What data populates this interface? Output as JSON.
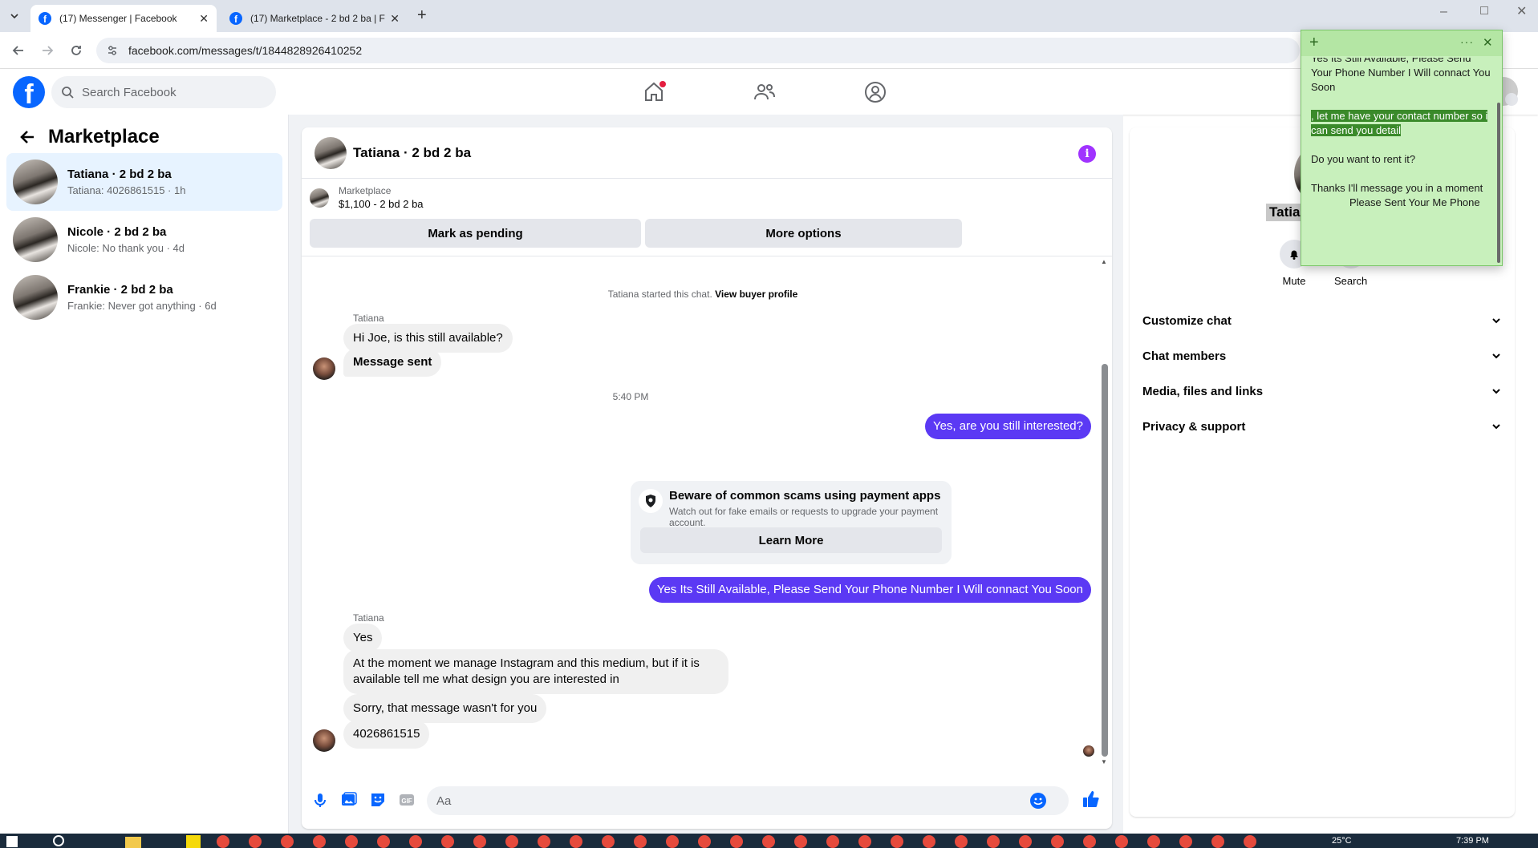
{
  "browser": {
    "tabs": [
      {
        "label": "(17) Messenger | Facebook",
        "active": true
      },
      {
        "label": "(17) Marketplace - 2 bd 2 ba | F",
        "active": false
      }
    ],
    "url": "facebook.com/messages/t/1844828926410252",
    "favicon_letter": "f"
  },
  "fb": {
    "logo_letter": "f",
    "search_placeholder": "Search Facebook",
    "nav_icons": [
      "home-icon",
      "friends-icon",
      "groups-icon"
    ]
  },
  "sidebar": {
    "title": "Marketplace",
    "conversations": [
      {
        "name": "Tatiana · 2 bd 2 ba",
        "preview": "Tatiana: 4026861515 · 1h",
        "selected": true
      },
      {
        "name": "Nicole · 2 bd 2 ba",
        "preview": "Nicole: No thank you · 4d",
        "selected": false
      },
      {
        "name": "Frankie · 2 bd 2 ba",
        "preview": "Frankie: Never got anything · 6d",
        "selected": false
      }
    ]
  },
  "chat": {
    "title": "Tatiana · 2 bd 2 ba",
    "info_glyph": "i",
    "listing": {
      "label": "Marketplace",
      "detail": "$1,100 - 2 bd 2 ba"
    },
    "actions": {
      "pending": "Mark as pending",
      "more": "More options"
    },
    "started_text": "Tatiana started this chat.",
    "view_profile": "View buyer profile",
    "sender_name": "Tatiana",
    "messages": {
      "m1": "Hi Joe, is this still available?",
      "m2": "Message sent",
      "time": "5:40 PM",
      "out1": "Yes, are you still interested?",
      "out2": "Yes Its Still Available, Please Send Your Phone Number I Will connact You Soon",
      "in_yes": "Yes",
      "in_long": "At the moment we manage Instagram and this medium, but if it is available tell me what design you are interested in",
      "in_sorry": "Sorry, that message wasn't for you",
      "in_phone": "4026861515"
    },
    "scam_notice": {
      "heading": "Beware of common scams using payment apps",
      "text": "Watch out for fake emails or requests to upgrade your payment account.",
      "button": "Learn More"
    },
    "composer_placeholder": "Aa"
  },
  "details": {
    "name_partial": "Tatian",
    "buttons": {
      "mute": "Mute",
      "search": "Search"
    },
    "sections": [
      "Customize chat",
      "Chat members",
      "Media, files and links",
      "Privacy & support"
    ]
  },
  "sticky_note": {
    "line_top": "Yes Its Still Available, Please Send Your Phone Number I Will connact You Soon",
    "highlight": ", let me have your contact number so i can send you detail",
    "q": "Do you want to rent it?",
    "thanks": "Thanks I'll message you in a moment",
    "bottom": "Please Sent Your Me Phone"
  },
  "taskbar": {
    "time": "7:39 PM",
    "temp": "25°C"
  },
  "colors": {
    "accent": "#0866ff",
    "outgoing_bubble": "#5b39f4",
    "selected_conv": "#e7f3ff",
    "sticky": "#c8f0bc",
    "sticky_highlight": "#3a8a2a"
  }
}
